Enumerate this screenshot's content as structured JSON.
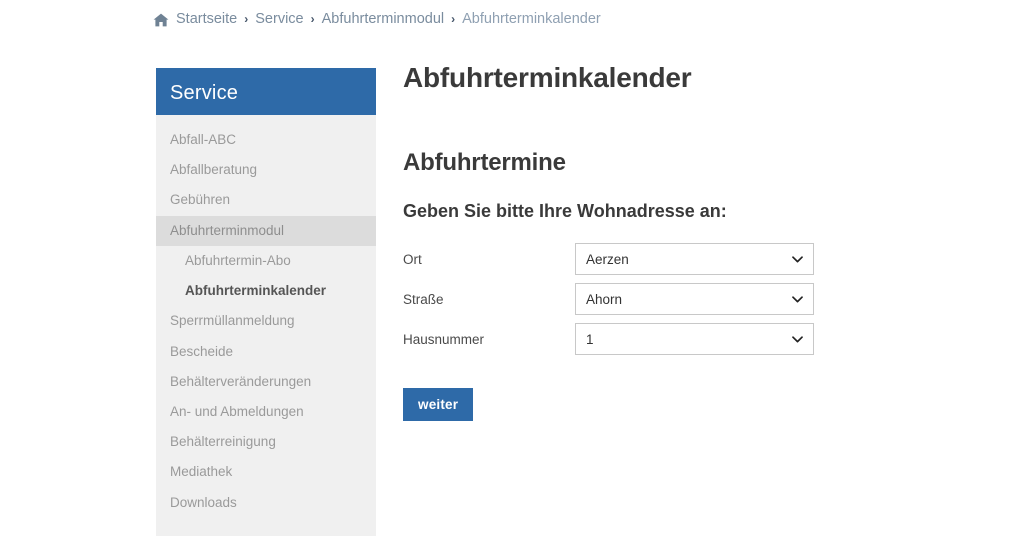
{
  "breadcrumb": {
    "home_icon": "home-icon",
    "separator": "›",
    "items": [
      {
        "label": "Startseite",
        "current": false
      },
      {
        "label": "Service",
        "current": false
      },
      {
        "label": "Abfuhrterminmodul",
        "current": false
      },
      {
        "label": "Abfuhrterminkalender",
        "current": true
      }
    ]
  },
  "sidebar": {
    "header": "Service",
    "header_bg": "#2e6aa8",
    "background": "#f0f0f0",
    "open_item_bg": "#dcdcdc",
    "items": [
      {
        "label": "Abfall-ABC",
        "level": 1,
        "state": "normal"
      },
      {
        "label": "Abfallberatung",
        "level": 1,
        "state": "normal"
      },
      {
        "label": "Gebühren",
        "level": 1,
        "state": "normal"
      },
      {
        "label": "Abfuhrterminmodul",
        "level": 1,
        "state": "open"
      },
      {
        "label": "Abfuhrtermin-Abo",
        "level": 2,
        "state": "normal"
      },
      {
        "label": "Abfuhrterminkalender",
        "level": 2,
        "state": "active"
      },
      {
        "label": "Sperrmüllanmeldung",
        "level": 1,
        "state": "normal"
      },
      {
        "label": "Bescheide",
        "level": 1,
        "state": "normal"
      },
      {
        "label": "Behälterveränderungen",
        "level": 1,
        "state": "normal"
      },
      {
        "label": "An- und Abmeldungen",
        "level": 1,
        "state": "normal"
      },
      {
        "label": "Behälterreinigung",
        "level": 1,
        "state": "normal"
      },
      {
        "label": "Mediathek",
        "level": 1,
        "state": "normal"
      },
      {
        "label": "Downloads",
        "level": 1,
        "state": "normal"
      }
    ]
  },
  "main": {
    "page_title": "Abfuhrterminkalender",
    "section_title": "Abfuhrtermine",
    "form_prompt": "Geben Sie bitte Ihre Wohnadresse an:",
    "form": {
      "fields": [
        {
          "label": "Ort",
          "value": "Aerzen",
          "icon": "chevron-down-icon"
        },
        {
          "label": "Straße",
          "value": "Ahorn",
          "icon": "chevron-down-icon"
        },
        {
          "label": "Hausnummer",
          "value": "1",
          "icon": "chevron-down-icon"
        }
      ],
      "submit_label": "weiter",
      "submit_bg": "#2e6aa8"
    }
  }
}
